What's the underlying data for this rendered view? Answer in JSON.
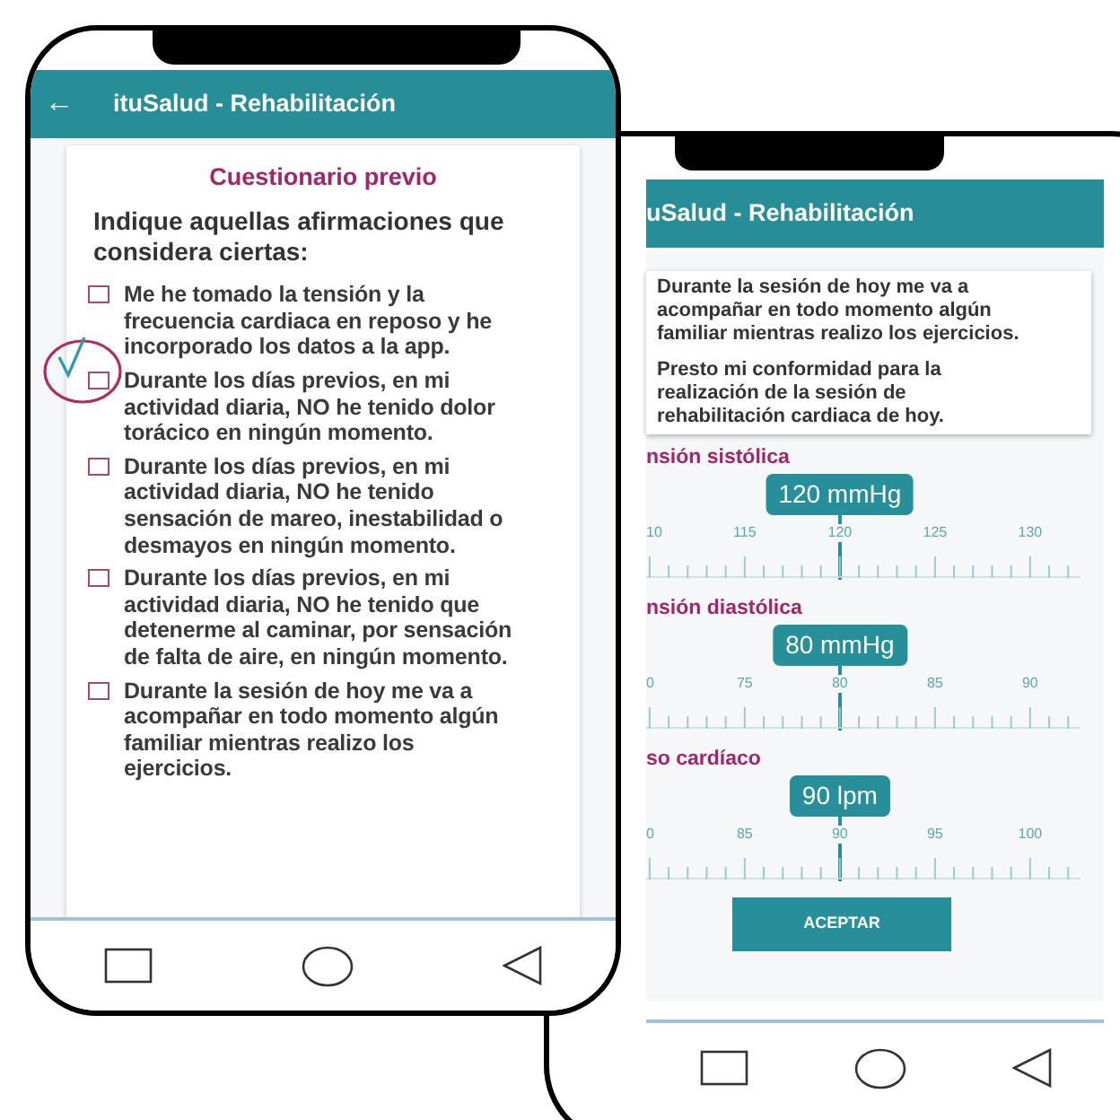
{
  "left_phone": {
    "header": {
      "back": "←",
      "title": "ituSalud - Rehabilitación"
    },
    "card": {
      "title": "Cuestionario previo",
      "prompt": "Indique aquellas afirmaciones que considera ciertas:",
      "items": [
        {
          "text": "Me he tomado la tensión y la frecuencia cardiaca en reposo y he incorporado los datos a la app.",
          "checked": false,
          "annotated": false
        },
        {
          "text": "Durante los días previos, en mi actividad diaria, NO he tenido dolor torácico en ningún momento.",
          "checked": false,
          "annotated": true
        },
        {
          "text": "Durante los días previos, en mi actividad diaria, NO he tenido sensación de mareo, inestabilidad o desmayos en ningún momento.",
          "checked": false,
          "annotated": false
        },
        {
          "text": "Durante los días previos, en mi actividad diaria, NO he tenido que detenerme al caminar, por sensación de falta de aire, en ningún momento.",
          "checked": false,
          "annotated": false
        },
        {
          "text": "Durante la sesión de hoy me va a acompañar en todo momento algún familiar mientras realizo los ejercicios.",
          "checked": false,
          "annotated": false
        }
      ]
    }
  },
  "right_phone": {
    "header": {
      "title": "uSalud - Rehabilitación"
    },
    "card": {
      "paragraphs": [
        "Durante la sesión de hoy me va a acompañar en todo momento algún familiar mientras realizo los ejercicios.",
        "Presto mi conformidad para la realización de la sesión de rehabilitación cardiaca de hoy."
      ]
    },
    "sliders": [
      {
        "label": "nsión sistólica",
        "value": "120 mmHg",
        "level": 0.446,
        "ticks": [
          "10",
          "115",
          "120",
          "125",
          "130"
        ]
      },
      {
        "label": "nsión diastólica",
        "value": "80 mmHg",
        "level": 0.446,
        "ticks": [
          "0",
          "75",
          "80",
          "85",
          "90"
        ]
      },
      {
        "label": "so cardíaco",
        "value": "90 lpm",
        "level": 0.446,
        "ticks": [
          "0",
          "85",
          "90",
          "95",
          "100"
        ]
      }
    ],
    "button": "ACEPTAR"
  }
}
